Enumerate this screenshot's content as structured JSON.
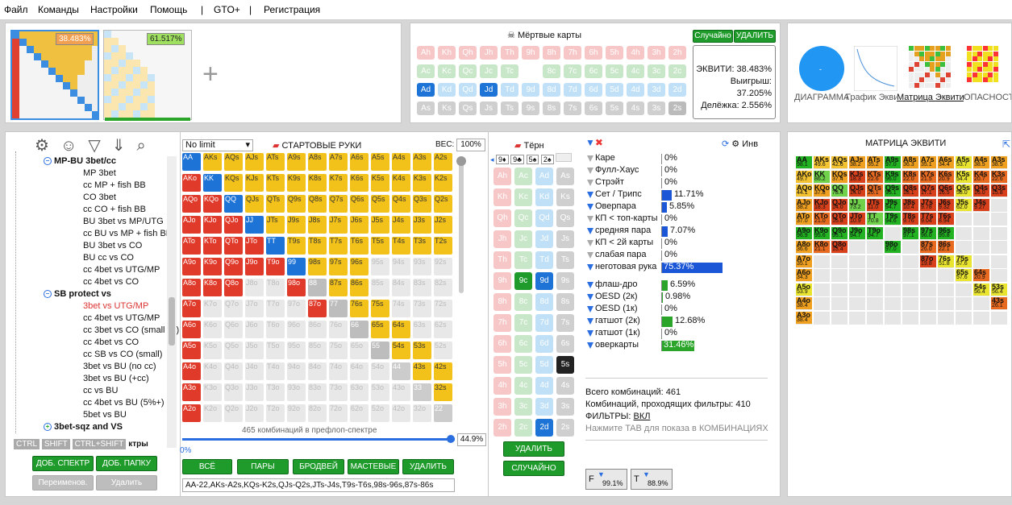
{
  "menu": [
    "Файл",
    "Команды",
    "Настройки",
    "Помощь",
    "|",
    "GTO+",
    "|",
    "Регистрация"
  ],
  "ranges": {
    "r1_eq": "38.483%",
    "r2_eq": "61.517%"
  },
  "dead": {
    "title": "Мёртвые карты",
    "random": "Случайно",
    "delete": "УДАЛИТЬ",
    "rows": [
      [
        "Ah",
        "Kh",
        "Qh",
        "Jh",
        "Th",
        "9h",
        "8h",
        "7h",
        "6h",
        "5h",
        "4h",
        "3h",
        "2h"
      ],
      [
        "Ac",
        "Kc",
        "Qc",
        "Jc",
        "Tc",
        "9c",
        "8c",
        "7c",
        "6c",
        "5c",
        "4c",
        "3c",
        "2c"
      ],
      [
        "Ad",
        "Kd",
        "Qd",
        "Jd",
        "Td",
        "9d",
        "8d",
        "7d",
        "6d",
        "5d",
        "4d",
        "3d",
        "2d"
      ],
      [
        "As",
        "Ks",
        "Qs",
        "Js",
        "Ts",
        "9s",
        "8s",
        "7s",
        "6s",
        "5s",
        "4s",
        "3s",
        "2s"
      ]
    ],
    "equity": "ЭКВИТИ: 38.483%",
    "win": "Выигрыш: 37.205%",
    "tie": "Делёжка: 2.556%"
  },
  "views": [
    "ДИАГРАММА",
    "График Экви",
    "Матрица Эквити",
    "ОПАСНОСТЬ"
  ],
  "tree": [
    {
      "t": "MP-BU 3bet/cc",
      "b": 1
    },
    {
      "t": "MP 3bet"
    },
    {
      "t": "cc MP + fish BB"
    },
    {
      "t": "CO 3bet"
    },
    {
      "t": "cc CO + fish BB"
    },
    {
      "t": "BU 3bet vs MP/UTG"
    },
    {
      "t": "cc BU vs MP + fish BB"
    },
    {
      "t": "BU 3bet vs CO"
    },
    {
      "t": "BU cc vs CO"
    },
    {
      "t": "cc 4bet vs UTG/MP"
    },
    {
      "t": "cc 4bet vs CO"
    },
    {
      "t": "SB protect vs",
      "b": 1
    },
    {
      "t": "3bet vs UTG/MP",
      "red": 1
    },
    {
      "t": "cc 4bet vs UTG/MP"
    },
    {
      "t": "cc 3bet vs CO (small cc)"
    },
    {
      "t": "cc 4bet vs CO"
    },
    {
      "t": "cc SB vs CO (small)"
    },
    {
      "t": "3bet vs BU (no cc)"
    },
    {
      "t": "3bet vs BU (+cc)"
    },
    {
      "t": "cc vs BU"
    },
    {
      "t": "cc 4bet vs BU (5%+)"
    },
    {
      "t": "5bet vs BU"
    },
    {
      "t": "3bet-sqz and VS",
      "b": 1
    }
  ],
  "tree_keys": [
    "CTRL",
    "SHIFT",
    "CTRL+SHIFT"
  ],
  "tree_extra": "ктры",
  "tree_buttons": {
    "add_spec": "ДОБ. СПЕКТР",
    "add_folder": "ДОБ. ПАПКУ",
    "rename": "Переименов.",
    "del": "Удалить"
  },
  "grid": {
    "limit": "No limit",
    "title": "СТАРТОВЫЕ РУКИ",
    "weight_label": "ВЕС:",
    "weight": "100%",
    "combos": "465 комбинаций в префлоп-спектре",
    "slider_left": "0%",
    "slider_right": "44.9%",
    "buttons": [
      "ВСЁ",
      "ПАРЫ",
      "БРОДВЕЙ",
      "МАСТЕВЫЕ",
      "УДАЛИТЬ"
    ],
    "text": "AA-22,AKs-A2s,KQs-K2s,QJs-Q2s,JTs-J4s,T9s-T6s,98s-96s,87s-86s"
  },
  "turn": {
    "title": "Тёрн",
    "board": [
      "9♦",
      "9♣",
      "5♠",
      "2♠"
    ],
    "delete": "УДАЛИТЬ",
    "random": "СЛУЧАЙНО"
  },
  "stats": {
    "inv": "Инв",
    "rows": [
      {
        "l": "Каре",
        "v": "0%",
        "w": 0
      },
      {
        "l": "Фулл-Хаус",
        "v": "0%",
        "w": 0
      },
      {
        "l": "Стрэйт",
        "v": "0%",
        "w": 0
      },
      {
        "l": "Сет / Трипс",
        "v": "11.71%",
        "w": 12
      },
      {
        "l": "Оверпара",
        "v": "5.85%",
        "w": 6
      },
      {
        "l": "КП < топ-карты",
        "v": "0%",
        "w": 0
      },
      {
        "l": "средняя пара",
        "v": "7.07%",
        "w": 7
      },
      {
        "l": "КП < 2й карты",
        "v": "0%",
        "w": 0
      },
      {
        "l": "слабая пара",
        "v": "0%",
        "w": 0
      },
      {
        "l": "неготовая рука",
        "v": "75.37%",
        "w": 75,
        "hl": 1
      }
    ],
    "draws": [
      {
        "l": "флаш-дро",
        "v": "6.59%",
        "w": 7
      },
      {
        "l": "OESD (2к)",
        "v": "0.98%",
        "w": 1
      },
      {
        "l": "OESD (1к)",
        "v": "0%",
        "w": 0
      },
      {
        "l": "гатшот (2к)",
        "v": "12.68%",
        "w": 13
      },
      {
        "l": "гатшот (1к)",
        "v": "0%",
        "w": 0
      },
      {
        "l": "оверкарты",
        "v": "31.46%",
        "w": 31,
        "hl": 1
      }
    ],
    "total": "Всего комбинаций: 461",
    "passed": "Комбинаций, проходящих фильтры: 410",
    "filters": "ФИЛЬТРЫ:",
    "filters_val": "ВКЛ",
    "hint": "Нажмите TAB для показа в КОМБИНАЦИЯХ",
    "f1": "99.1%",
    "f2": "88.9%"
  },
  "matrix": {
    "title": "МАТРИЦА ЭКВИТИ"
  },
  "chart_data": {
    "type": "heatmap",
    "title": "МАТРИЦА ЭКВИТИ",
    "cells": [
      [
        "AA",
        "98.1",
        0,
        0
      ],
      [
        "AKs",
        "49.6",
        0,
        1
      ],
      [
        "AQs",
        "42.6",
        0,
        2
      ],
      [
        "AJs",
        "38.2",
        0,
        3
      ],
      [
        "ATs",
        "35.2",
        0,
        4
      ],
      [
        "A9s",
        "97.0",
        0,
        5
      ],
      [
        "A8s",
        "36.3",
        0,
        6
      ],
      [
        "A7s",
        "35.1",
        0,
        7
      ],
      [
        "A6s",
        "34.4",
        0,
        8
      ],
      [
        "A5s",
        "53.7",
        0,
        9
      ],
      [
        "A4s",
        "38.5",
        0,
        10
      ],
      [
        "A3s",
        "38.5",
        0,
        11
      ],
      [
        "AKo",
        "49.7",
        1,
        0
      ],
      [
        "KK",
        "86.2",
        1,
        1
      ],
      [
        "KQs",
        "37.4",
        1,
        2
      ],
      [
        "KJs",
        "18.3",
        1,
        3
      ],
      [
        "KTs",
        "22.6",
        1,
        4
      ],
      [
        "K9s",
        "96.0",
        1,
        5
      ],
      [
        "K8s",
        "22.0",
        1,
        6
      ],
      [
        "K7s",
        "21.5",
        1,
        7
      ],
      [
        "K6s",
        "20.9",
        1,
        8
      ],
      [
        "K5s",
        "54.4",
        1,
        9
      ],
      [
        "K4s",
        "20.7",
        1,
        10
      ],
      [
        "K3s",
        "22.6",
        1,
        11
      ],
      [
        "AQo",
        "44.1",
        2,
        0
      ],
      [
        "KQo",
        "37.8",
        2,
        1
      ],
      [
        "QQ",
        "78.4",
        2,
        2
      ],
      [
        "QJs",
        "14.0",
        2,
        3
      ],
      [
        "QTs",
        "20.1",
        2,
        4
      ],
      [
        "Q9s",
        "95.1",
        2,
        5
      ],
      [
        "Q8s",
        "18.1",
        2,
        6
      ],
      [
        "Q7s",
        "17.1",
        2,
        7
      ],
      [
        "Q6s",
        "16.5",
        2,
        8
      ],
      [
        "Q5s",
        "58.0",
        2,
        9
      ],
      [
        "Q4s",
        "16.0",
        2,
        10
      ],
      [
        "Q3s",
        "15.8",
        2,
        11
      ],
      [
        "AJo",
        "38.2",
        3,
        0
      ],
      [
        "KJo",
        "18.3",
        3,
        1
      ],
      [
        "QJo",
        "14.0",
        3,
        2
      ],
      [
        "JJ",
        "73.2",
        3,
        3
      ],
      [
        "JTs",
        "11.0",
        3,
        4
      ],
      [
        "J9s",
        "94.7",
        3,
        5
      ],
      [
        "J8s",
        "10.4",
        3,
        6
      ],
      [
        "J7s",
        "9.78",
        3,
        7
      ],
      [
        "J6s",
        "9.32",
        3,
        8
      ],
      [
        "J5s",
        "62.0",
        3,
        9
      ],
      [
        "J4s",
        "9.27",
        3,
        10
      ],
      [
        "ATo",
        "37.0",
        4,
        0
      ],
      [
        "KTo",
        "21.0",
        4,
        1
      ],
      [
        "QTo",
        "16.8",
        4,
        2
      ],
      [
        "JTo",
        "10.9",
        4,
        3
      ],
      [
        "TT",
        "70.8",
        4,
        4
      ],
      [
        "T9s",
        "94.6",
        4,
        5
      ],
      [
        "T8s",
        "9.76",
        4,
        6
      ],
      [
        "T7s",
        "9.04",
        4,
        7
      ],
      [
        "T6s",
        "8.94",
        4,
        8
      ],
      [
        "A9o",
        "96.9",
        5,
        0
      ],
      [
        "K9o",
        "95.6",
        5,
        1
      ],
      [
        "Q9o",
        "95.1",
        5,
        2
      ],
      [
        "J9o",
        "94.7",
        5,
        3
      ],
      [
        "T9o",
        "94.7",
        5,
        4
      ],
      [
        "98s",
        "97.1",
        5,
        6
      ],
      [
        "97s",
        "96.0",
        5,
        7
      ],
      [
        "96s",
        "95.8",
        5,
        8
      ],
      [
        "A8o",
        "36.6",
        6,
        0
      ],
      [
        "K8o",
        "21.1",
        6,
        1
      ],
      [
        "Q8o",
        "13.4",
        6,
        2
      ],
      [
        "98o",
        "97.0",
        6,
        5
      ],
      [
        "87s",
        "26.0",
        6,
        7
      ],
      [
        "86s",
        "22.1",
        6,
        8
      ],
      [
        "A7o",
        "35.1",
        7,
        0
      ],
      [
        "87o",
        "19.8",
        7,
        7
      ],
      [
        "76s",
        "51.8",
        7,
        8
      ],
      [
        "75s",
        "57.6",
        7,
        9
      ],
      [
        "A6o",
        "34.3",
        8,
        0
      ],
      [
        "65s",
        "57.6",
        8,
        9
      ],
      [
        "64s",
        "20.9",
        8,
        10
      ],
      [
        "A5o",
        "53.9",
        9,
        0
      ],
      [
        "54s",
        "56.4",
        9,
        10
      ],
      [
        "53s",
        "56.4",
        9,
        11
      ],
      [
        "A4o",
        "38.4",
        10,
        0
      ],
      [
        "43s",
        "26.1",
        10,
        11
      ],
      [
        "A3o",
        "38.4",
        11,
        0
      ]
    ]
  }
}
